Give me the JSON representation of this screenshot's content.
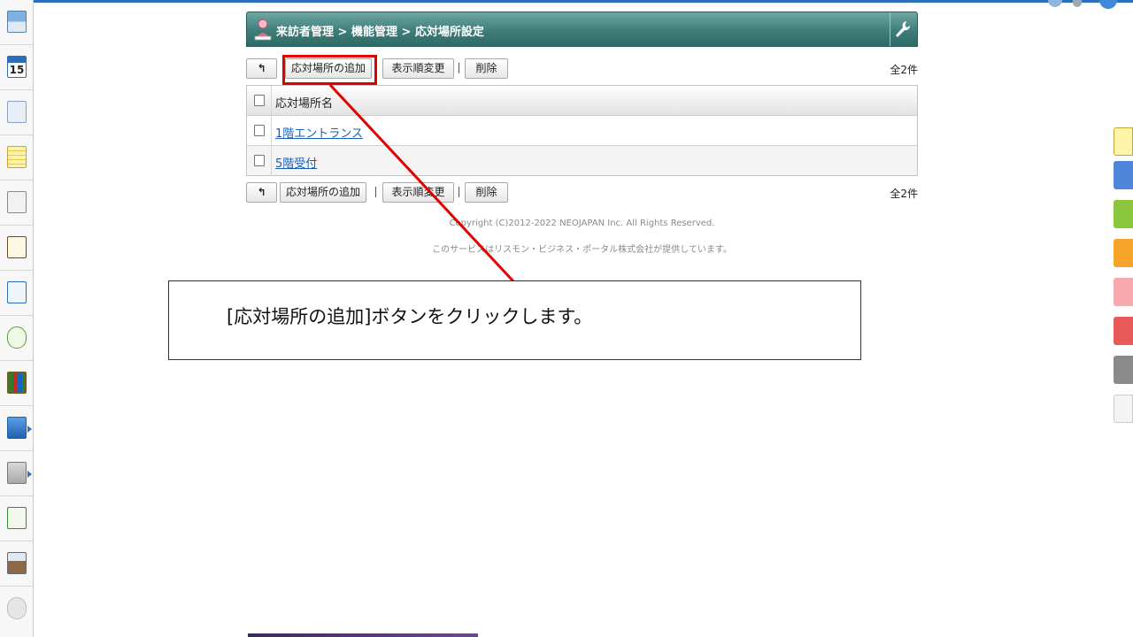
{
  "header": {
    "title": "来訪者管理 > 機能管理 > 応対場所設定",
    "bg_color": "#3e7d79"
  },
  "toolbar_top": {
    "back_label": "",
    "add_label": "応対場所の追加",
    "order_label": "表示順変更",
    "separator": "|",
    "delete_label": "削除",
    "count": "全2件"
  },
  "toolbar_bottom": {
    "back_label": "",
    "add_label": "応対場所の追加",
    "order_label": "表示順変更",
    "separator": "|",
    "delete_label": "削除",
    "count": "全2件"
  },
  "table": {
    "column_header": "応対場所名",
    "rows": [
      {
        "name": "1階エントランス"
      },
      {
        "name": "5階受付"
      }
    ]
  },
  "footer": {
    "copyright": "Copyright (C)2012-2022 NEOJAPAN Inc. All Rights Reserved.",
    "provider": "このサービスはリスモン・ビジネス・ポータル株式会社が提供しています。"
  },
  "callout": {
    "text": "[応対場所の追加]ボタンをクリックします。",
    "highlight_color": "#e00000"
  },
  "sidebar": {
    "calendar_day": "15",
    "items": [
      "portal-icon",
      "calendar-icon",
      "visitor-icon",
      "memo-icon",
      "board-icon",
      "clipboard-icon",
      "search-check-icon",
      "recycle-icon",
      "cabinet-icon",
      "neo-icon",
      "folder-icon",
      "app-badge-icon",
      "photo-badge-icon",
      "gear-icon"
    ]
  },
  "right_tabs": [
    "note-tab",
    "blue-tab",
    "green-tab",
    "orange-tab",
    "pink-tab",
    "red-tab",
    "gray-tab",
    "pencil-tab"
  ]
}
